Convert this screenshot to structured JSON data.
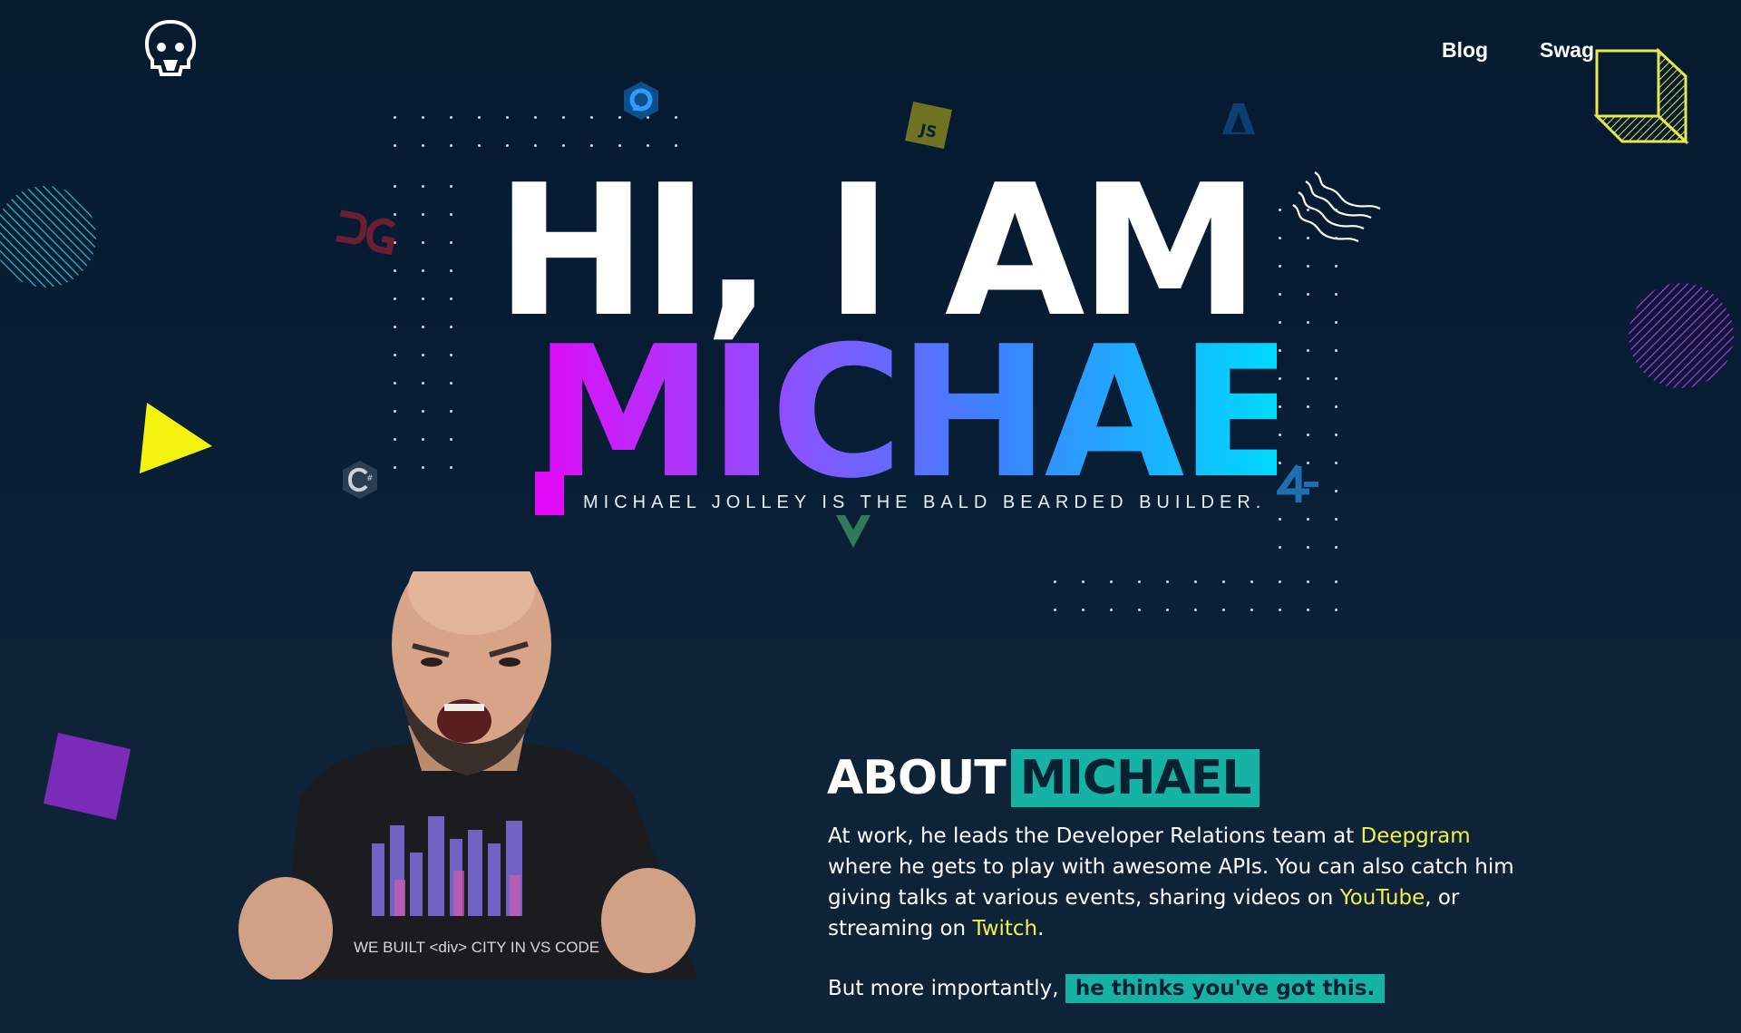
{
  "nav": {
    "blog": "Blog",
    "swag": "Swag"
  },
  "hero": {
    "line1": "HI, I AM",
    "line2": "MICHAEL",
    "tagline": "MICHAEL JOLLEY IS THE BALD BEARDED BUILDER."
  },
  "about": {
    "title": "ABOUT",
    "title_highlight": "MICHAEL",
    "p1_a": "At work, he leads the Developer Relations team at ",
    "p1_link1": "Deepgram",
    "p1_b": " where he gets to play with awesome APIs. You can also catch him giving talks at various events, sharing videos on ",
    "p1_link2": "YouTube",
    "p1_c": ", or streaming on ",
    "p1_link3": "Twitch",
    "p1_d": ".",
    "p2_a": "But more importantly, ",
    "p2_highlight": "he thinks you've got this."
  },
  "shirt_text": "WE BUILT <div> CITY IN VS CODE",
  "icons": {
    "logo": "bald-bearded-skull-logo-icon",
    "js": "javascript-icon",
    "csharp": "csharp-icon",
    "vue": "vue-icon",
    "digitalocean": "digitalocean-icon",
    "azure": "azure-icon",
    "deepgram": "deepgram-icon",
    "a4": "a4-icon"
  },
  "colors": {
    "background": "#061a30",
    "about_bg": "#0f2338",
    "accent_teal": "#16b3a4",
    "accent_yellow": "#f2f04a",
    "gradient_start": "#e10bf7",
    "gradient_end": "#00d9ff"
  }
}
